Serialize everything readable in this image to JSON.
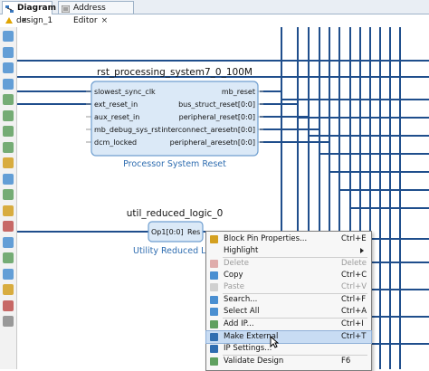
{
  "tabs": [
    {
      "label": "Diagram",
      "active": true
    },
    {
      "label": "Address Editor",
      "active": false
    }
  ],
  "tab_close_glyph": "×",
  "breadcrumb": "design_1",
  "toolbar_icons": [
    "zoom-in-icon",
    "zoom-out-icon",
    "zoom-fit-icon",
    "zoom-area-icon",
    "select-area-icon",
    "expand-icon",
    "collapse-icon",
    "fit-selection-icon",
    "search-icon",
    "validate-icon",
    "add-ip-icon",
    "route-icon",
    "regenerate-icon",
    "pin-icon",
    "refresh-icon",
    "settings-icon",
    "layout-icon",
    "highlight-icon",
    "cut-icon"
  ],
  "block1": {
    "title": "rst_processing_system7_0_100M",
    "subtitle": "Processor System Reset",
    "left_ports": [
      "slowest_sync_clk",
      "ext_reset_in",
      "aux_reset_in",
      "mb_debug_sys_rst",
      "dcm_locked"
    ],
    "right_ports": [
      "mb_reset",
      "bus_struct_reset[0:0]",
      "peripheral_reset[0:0]",
      "interconnect_aresetn[0:0]",
      "peripheral_aresetn[0:0]"
    ]
  },
  "block2": {
    "title": "util_reduced_logic_0",
    "subtitle": "Utility Reduced Lo",
    "in_port": "Op1[0:0]",
    "out_port": "Res"
  },
  "context_menu": [
    {
      "label": "Block Pin Properties...",
      "shortcut": "Ctrl+E",
      "icon": "properties-icon",
      "disabled": false
    },
    {
      "label": "Highlight",
      "shortcut": "",
      "icon": "",
      "disabled": false,
      "submenu": true
    },
    {
      "label": "Delete",
      "shortcut": "Delete",
      "icon": "delete-icon",
      "disabled": true
    },
    {
      "label": "Copy",
      "shortcut": "Ctrl+C",
      "icon": "copy-icon",
      "disabled": false
    },
    {
      "label": "Paste",
      "shortcut": "Ctrl+V",
      "icon": "paste-icon",
      "disabled": true
    },
    {
      "label": "Search...",
      "shortcut": "Ctrl+F",
      "icon": "search-icon",
      "disabled": false
    },
    {
      "label": "Select All",
      "shortcut": "Ctrl+A",
      "icon": "select-all-icon",
      "disabled": false
    },
    {
      "label": "Add IP...",
      "shortcut": "Ctrl+I",
      "icon": "add-ip-icon",
      "disabled": false
    },
    {
      "label": "Make External",
      "shortcut": "Ctrl+T",
      "icon": "make-external-icon",
      "disabled": false,
      "highlighted": true
    },
    {
      "label": "IP Settings...",
      "shortcut": "",
      "icon": "ip-settings-icon",
      "disabled": false
    },
    {
      "label": "Validate Design",
      "shortcut": "F6",
      "icon": "validate-icon",
      "disabled": false
    }
  ],
  "colors": {
    "wire": "#1f4e8c",
    "block_fill": "#dbe9f7",
    "block_stroke": "#6f9fd0",
    "subtitle": "#2f6db0",
    "menu_highlight": "#c8dcf3"
  }
}
